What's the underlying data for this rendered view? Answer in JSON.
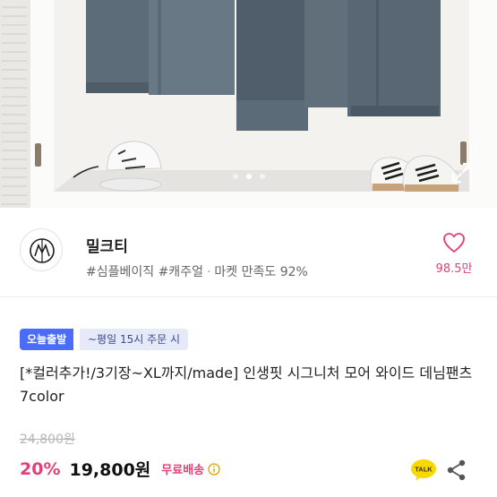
{
  "shop": {
    "name": "밀크티",
    "tags": "#심플베이직 #캐주얼",
    "satisfaction_label": "마켓 만족도",
    "satisfaction_value": "92%",
    "likes": "98.5만"
  },
  "gallery": {
    "slide_count": 3,
    "active_slide": 2
  },
  "product": {
    "badge": "오늘출발",
    "badge_note": "~평일 15시 주문 시",
    "title": "[*컬러추가!/3기장~XL까지/made] 인생핏 시그니처 모어 와이드 데님팬츠 7color",
    "original_price": "24,800원",
    "discount": "20%",
    "price": "19,800원",
    "shipping": "무료배송"
  },
  "actions": {
    "talk_label": "TALK"
  },
  "colors": {
    "accent": "#e0417a",
    "badge": "#4a6cf7",
    "badge_note_bg": "#e6eaf8"
  },
  "icons": [
    "expand-icon",
    "heart-icon",
    "info-icon",
    "talk-icon",
    "share-icon"
  ]
}
